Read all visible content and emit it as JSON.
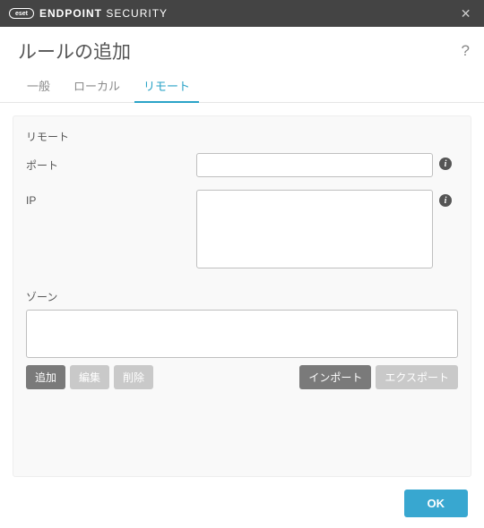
{
  "brand": {
    "logo_text": "eset",
    "name_bold": "ENDPOINT",
    "name_rest": " SECURITY"
  },
  "page_title": "ルールの追加",
  "tabs": {
    "general": "一般",
    "local": "ローカル",
    "remote": "リモート"
  },
  "section_label": "リモート",
  "fields": {
    "port": {
      "label": "ポート",
      "value": ""
    },
    "ip": {
      "label": "IP",
      "value": ""
    }
  },
  "zone": {
    "label": "ゾーン",
    "buttons": {
      "add": "追加",
      "edit": "編集",
      "delete": "削除",
      "import": "インポート",
      "export": "エクスポート"
    }
  },
  "footer": {
    "ok": "OK"
  },
  "icons": {
    "info": "i",
    "help": "?",
    "close": "✕"
  }
}
